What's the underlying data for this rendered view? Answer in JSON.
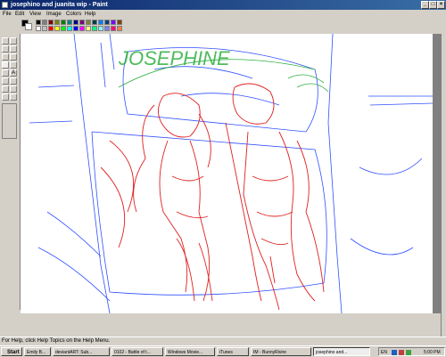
{
  "window": {
    "title": "josephino and juanita wip - Paint"
  },
  "menu": [
    "File",
    "Edit",
    "View",
    "Image",
    "Colors",
    "Help"
  ],
  "palette": [
    "#000000",
    "#808080",
    "#800000",
    "#808000",
    "#008000",
    "#008080",
    "#000080",
    "#800080",
    "#808040",
    "#004040",
    "#0080ff",
    "#004080",
    "#8000ff",
    "#804000",
    "#ffffff",
    "#c0c0c0",
    "#ff0000",
    "#ffff00",
    "#00ff00",
    "#00ffff",
    "#0000ff",
    "#ff00ff",
    "#ffff80",
    "#00ff80",
    "#80ffff",
    "#8080ff",
    "#ff0080",
    "#ff8040"
  ],
  "canvas_text": "JOSEPHINE",
  "status": "For Help, click Help Topics on the Help Menu.",
  "taskbar": {
    "start": "Start",
    "tasks": [
      "Emily B...",
      "deviantART: Sub...",
      "0102 - Battle of t...",
      "Windows Movie...",
      "iTunes",
      "IM - BunnyRivire",
      "josephino and..."
    ],
    "lang": "EN",
    "clock": "5:00 PM"
  }
}
